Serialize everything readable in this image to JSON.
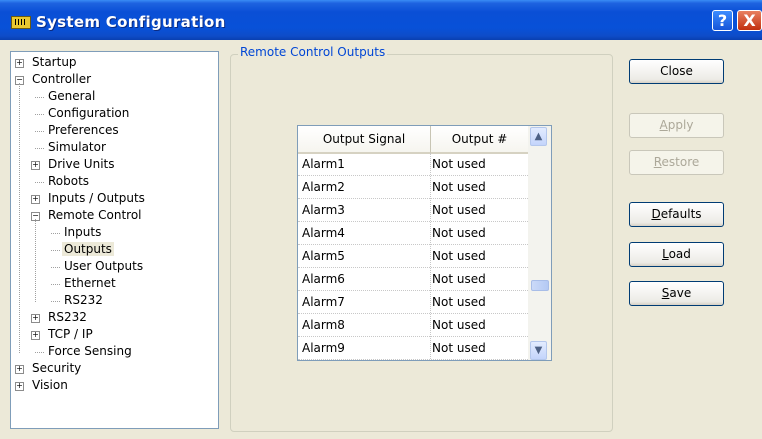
{
  "window": {
    "title": "System Configuration"
  },
  "tree": [
    {
      "label": "Startup",
      "depth": 0,
      "expander": "+"
    },
    {
      "label": "Controller",
      "depth": 0,
      "expander": "-"
    },
    {
      "label": "General",
      "depth": 1,
      "expander": ""
    },
    {
      "label": "Configuration",
      "depth": 1,
      "expander": ""
    },
    {
      "label": "Preferences",
      "depth": 1,
      "expander": ""
    },
    {
      "label": "Simulator",
      "depth": 1,
      "expander": ""
    },
    {
      "label": "Drive Units",
      "depth": 1,
      "expander": "+"
    },
    {
      "label": "Robots",
      "depth": 1,
      "expander": ""
    },
    {
      "label": "Inputs / Outputs",
      "depth": 1,
      "expander": "+"
    },
    {
      "label": "Remote Control",
      "depth": 1,
      "expander": "-"
    },
    {
      "label": "Inputs",
      "depth": 2,
      "expander": ""
    },
    {
      "label": "Outputs",
      "depth": 2,
      "expander": "",
      "selected": true
    },
    {
      "label": "User Outputs",
      "depth": 2,
      "expander": ""
    },
    {
      "label": "Ethernet",
      "depth": 2,
      "expander": ""
    },
    {
      "label": "RS232",
      "depth": 2,
      "expander": ""
    },
    {
      "label": "RS232",
      "depth": 1,
      "expander": "+"
    },
    {
      "label": "TCP / IP",
      "depth": 1,
      "expander": "+"
    },
    {
      "label": "Force Sensing",
      "depth": 1,
      "expander": ""
    },
    {
      "label": "Security",
      "depth": 0,
      "expander": "+"
    },
    {
      "label": "Vision",
      "depth": 0,
      "expander": "+"
    }
  ],
  "group": {
    "title": "Remote Control Outputs"
  },
  "table": {
    "headers": [
      "Output Signal",
      "Output #"
    ],
    "rows": [
      [
        "Alarm1",
        "Not used"
      ],
      [
        "Alarm2",
        "Not used"
      ],
      [
        "Alarm3",
        "Not used"
      ],
      [
        "Alarm4",
        "Not used"
      ],
      [
        "Alarm5",
        "Not used"
      ],
      [
        "Alarm6",
        "Not used"
      ],
      [
        "Alarm7",
        "Not used"
      ],
      [
        "Alarm8",
        "Not used"
      ],
      [
        "Alarm9",
        "Not used"
      ]
    ]
  },
  "buttons": {
    "close": {
      "label": "Close",
      "enabled": true
    },
    "apply": {
      "label": "Apply",
      "mnemonic": "A",
      "enabled": false
    },
    "restore": {
      "label": "Restore",
      "mnemonic": "R",
      "enabled": false
    },
    "defaults": {
      "label": "Defaults",
      "mnemonic": "D",
      "enabled": true
    },
    "load": {
      "label": "Load",
      "mnemonic": "L",
      "enabled": true
    },
    "save": {
      "label": "Save",
      "mnemonic": "S",
      "enabled": true
    }
  },
  "title_buttons": {
    "help": "?",
    "close": "X"
  },
  "icons": [
    "app-icon",
    "help-icon",
    "close-icon",
    "scroll-up-icon",
    "scroll-down-icon"
  ]
}
